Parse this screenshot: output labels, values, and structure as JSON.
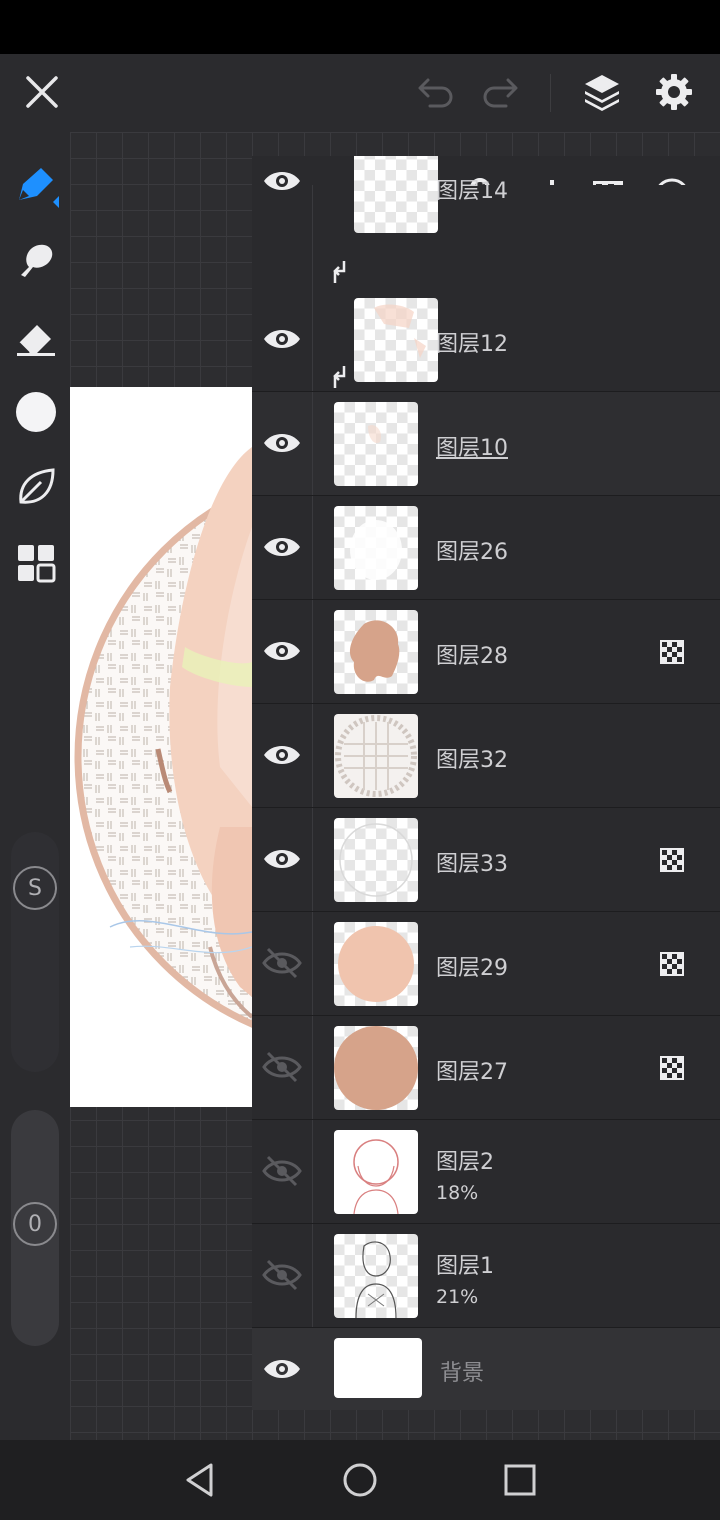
{
  "top_bar": {
    "close": "close-icon",
    "undo": "undo-icon",
    "redo": "redo-icon",
    "layers": "layers-icon",
    "settings": "gear-icon"
  },
  "tools": [
    {
      "name": "pen-tool",
      "icon": "pen-icon"
    },
    {
      "name": "smudge-tool",
      "icon": "smudge-icon"
    },
    {
      "name": "eraser-tool",
      "icon": "eraser-icon"
    },
    {
      "name": "color-picker",
      "icon": "color-dot-icon",
      "color": "#f4f4f6"
    },
    {
      "name": "leaf-tool",
      "icon": "leaf-icon"
    },
    {
      "name": "grid-tool",
      "icon": "grid-icon"
    }
  ],
  "sliders": {
    "size_label": "S",
    "opacity_label": "0"
  },
  "layer_panel": {
    "toolbar": [
      "add-icon",
      "folder-icon",
      "lock-icon",
      "clip-icon",
      "alpha-lock-icon",
      "blend-icon"
    ],
    "layers": [
      {
        "name": "图层14",
        "visible": true,
        "clipped": true,
        "partial": true
      },
      {
        "name": "图层12",
        "visible": true,
        "clipped": true
      },
      {
        "name": "图层10",
        "visible": true,
        "selected": true
      },
      {
        "name": "图层26",
        "visible": true
      },
      {
        "name": "图层28",
        "visible": true,
        "alpha_locked": true
      },
      {
        "name": "图层32",
        "visible": true
      },
      {
        "name": "图层33",
        "visible": true,
        "alpha_locked": true
      },
      {
        "name": "图层29",
        "visible": false,
        "alpha_locked": true
      },
      {
        "name": "图层27",
        "visible": false,
        "alpha_locked": true
      },
      {
        "name": "图层2",
        "visible": false,
        "opacity": "18%"
      },
      {
        "name": "图层1",
        "visible": false,
        "opacity": "21%"
      },
      {
        "name": "背景",
        "visible": true,
        "background": true
      }
    ]
  },
  "colors": {
    "accent": "#1e90ff",
    "panel_bg": "#2a2a2d",
    "skin": "#f0c4ae",
    "hair": "#d6a38a"
  },
  "nav": [
    "back-icon",
    "home-icon",
    "recents-icon"
  ]
}
